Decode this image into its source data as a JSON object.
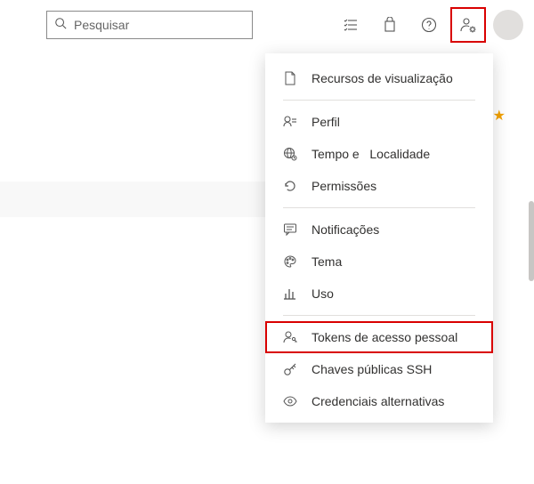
{
  "search": {
    "placeholder": "Pesquisar"
  },
  "menu": {
    "preview": "Recursos de visualização",
    "profile": "Perfil",
    "timeAnd": "Tempo e",
    "locale": "Localidade",
    "permissions": "Permissões",
    "notifications": "Notificações",
    "theme": "Tema",
    "usage": "Uso",
    "pat": "Tokens de acesso pessoal",
    "ssh": "Chaves públicas SSH",
    "altcred": "Credenciais alternativas"
  }
}
